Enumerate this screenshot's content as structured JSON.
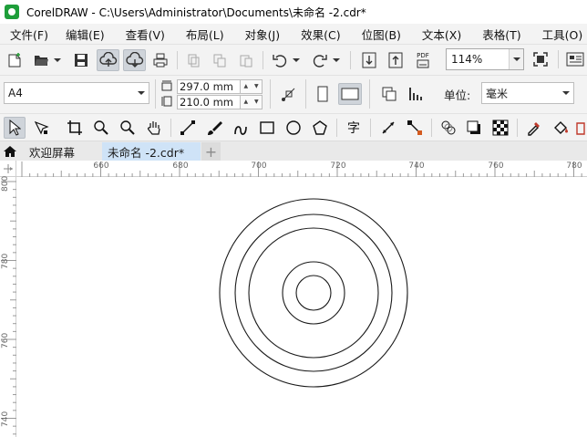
{
  "window": {
    "title": "CorelDRAW - C:\\Users\\Administrator\\Documents\\未命名 -2.cdr*"
  },
  "menu": [
    {
      "label": "文件(F)"
    },
    {
      "label": "编辑(E)"
    },
    {
      "label": "查看(V)"
    },
    {
      "label": "布局(L)"
    },
    {
      "label": "对象(J)"
    },
    {
      "label": "效果(C)"
    },
    {
      "label": "位图(B)"
    },
    {
      "label": "文本(X)"
    },
    {
      "label": "表格(T)"
    },
    {
      "label": "工具(O)"
    }
  ],
  "standard_toolbar": {
    "pdf_label": "PDF",
    "zoom_value": "114%"
  },
  "property_bar": {
    "page_size": "A4",
    "width_value": "297.0 mm",
    "height_value": "210.0 mm",
    "unit_label": "单位:",
    "unit_value": "毫米"
  },
  "tabs": {
    "welcome": "欢迎屏幕",
    "document": "未命名 -2.cdr*"
  },
  "rulers": {
    "horizontal": [
      "660",
      "680",
      "700",
      "720",
      "740",
      "760",
      "780"
    ],
    "vertical": [
      "800",
      "780",
      "760",
      "740"
    ]
  },
  "drawing": {
    "circles_radius_px": "",
    "stroke_color": "#1a1a1a"
  },
  "colors": {
    "toolbar_bg": "#f3f3f3",
    "active_tab": "#cfe3f7"
  }
}
